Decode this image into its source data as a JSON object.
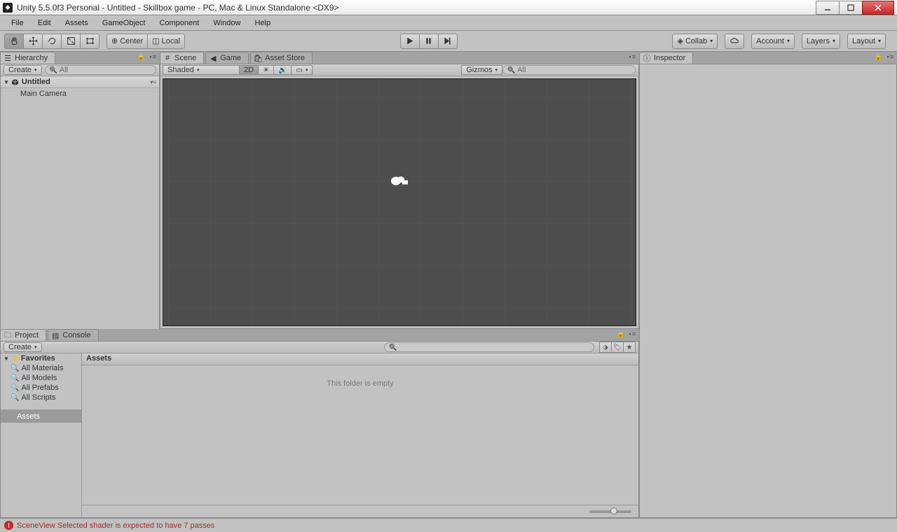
{
  "window": {
    "title": "Unity 5.5.0f3 Personal - Untitled - Skillbox game - PC, Mac & Linux Standalone <DX9>"
  },
  "menu": {
    "items": [
      "File",
      "Edit",
      "Assets",
      "GameObject",
      "Component",
      "Window",
      "Help"
    ]
  },
  "toolbar": {
    "center": "Center",
    "local": "Local",
    "collab": "Collab",
    "account": "Account",
    "layers": "Layers",
    "layout": "Layout"
  },
  "hierarchy": {
    "tab": "Hierarchy",
    "create": "Create",
    "search_ph": "All",
    "scene": "Untitled",
    "items": [
      "Main Camera"
    ]
  },
  "sceneTabs": {
    "scene": "Scene",
    "game": "Game",
    "asset_store": "Asset Store"
  },
  "sceneBar": {
    "shaded": "Shaded",
    "twoD": "2D",
    "gizmos": "Gizmos",
    "search_ph": "All"
  },
  "inspector": {
    "tab": "Inspector"
  },
  "project": {
    "tab_proj": "Project",
    "tab_console": "Console",
    "create": "Create",
    "favorites": "Favorites",
    "fav_items": [
      "All Materials",
      "All Models",
      "All Prefabs",
      "All Scripts"
    ],
    "assets": "Assets",
    "breadcrumb": "Assets",
    "empty": "This folder is empty"
  },
  "status": {
    "msg": "SceneView Selected shader is expected to have 7 passes"
  }
}
